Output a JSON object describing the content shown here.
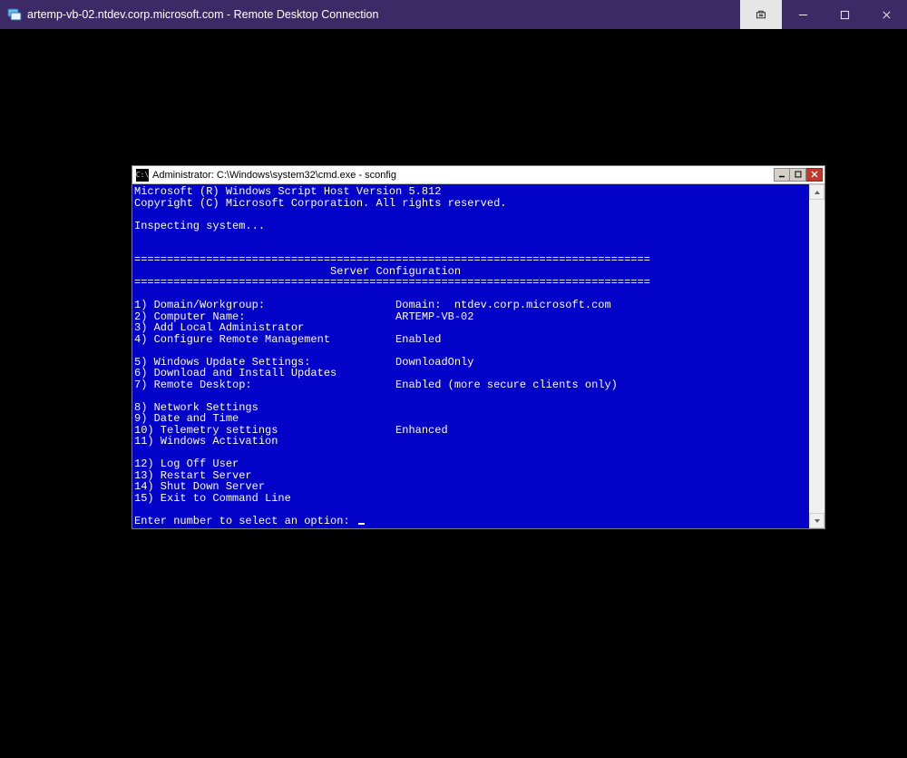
{
  "rdp": {
    "title": "artemp-vb-02.ntdev.corp.microsoft.com - Remote Desktop Connection"
  },
  "cmd": {
    "title": "Administrator: C:\\Windows\\system32\\cmd.exe - sconfig",
    "icon_text": "C:\\",
    "header_line1": "Microsoft (R) Windows Script Host Version 5.812",
    "header_line2": "Copyright (C) Microsoft Corporation. All rights reserved.",
    "inspecting": "Inspecting system...",
    "sep": "===============================================================================",
    "section_title": "                              Server Configuration",
    "menu": {
      "i1": "1) Domain/Workgroup:                    Domain:  ntdev.corp.microsoft.com",
      "i2": "2) Computer Name:                       ARTEMP-VB-02",
      "i3": "3) Add Local Administrator",
      "i4": "4) Configure Remote Management          Enabled",
      "i5": "5) Windows Update Settings:             DownloadOnly",
      "i6": "6) Download and Install Updates",
      "i7": "7) Remote Desktop:                      Enabled (more secure clients only)",
      "i8": "8) Network Settings",
      "i9": "9) Date and Time",
      "i10": "10) Telemetry settings                  Enhanced",
      "i11": "11) Windows Activation",
      "i12": "12) Log Off User",
      "i13": "13) Restart Server",
      "i14": "14) Shut Down Server",
      "i15": "15) Exit to Command Line"
    },
    "prompt": "Enter number to select an option: "
  }
}
